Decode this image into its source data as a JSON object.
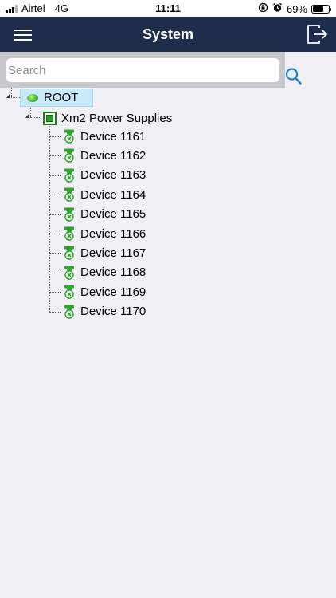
{
  "status_bar": {
    "carrier": "Airtel",
    "network": "4G",
    "time": "11:11",
    "battery_percent": "69%",
    "battery_level": 0.69,
    "icons": [
      "signal-icon",
      "rotation-lock-icon",
      "alarm-icon",
      "battery-icon"
    ]
  },
  "nav": {
    "title": "System",
    "menu_icon": "hamburger-menu-icon",
    "logout_icon": "logout-icon"
  },
  "search": {
    "placeholder": "Search",
    "value": "",
    "icon": "search-icon"
  },
  "tree": {
    "root": {
      "label": "ROOT",
      "icon": "green-led-icon",
      "selected": true
    },
    "group": {
      "label": "Xm2 Power Supplies",
      "icon": "group-box-icon"
    },
    "devices": [
      {
        "label": "Device 1161"
      },
      {
        "label": "Device 1162"
      },
      {
        "label": "Device 1163"
      },
      {
        "label": "Device 1164"
      },
      {
        "label": "Device 1165"
      },
      {
        "label": "Device 1166"
      },
      {
        "label": "Device 1167"
      },
      {
        "label": "Device 1168"
      },
      {
        "label": "Device 1169"
      },
      {
        "label": "Device 1170"
      }
    ],
    "device_icon": "power-supply-icon"
  },
  "colors": {
    "nav_background": "#1f2d4d",
    "search_area": "#c7c7cc",
    "page_background": "#efeff4",
    "selection": "#c8e9f8",
    "accent": "#1a7fd4",
    "device_green": "#2fa52f"
  }
}
